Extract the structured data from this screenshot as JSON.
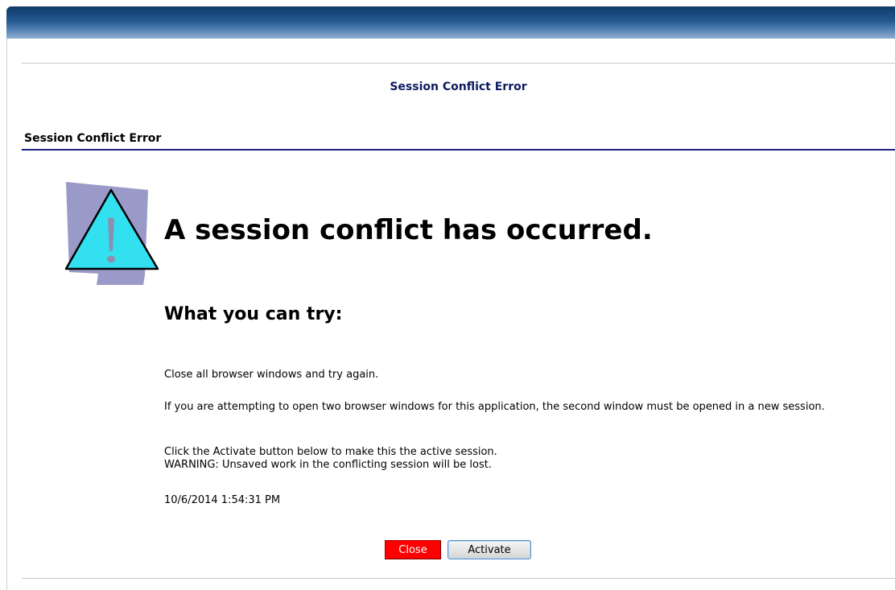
{
  "header": {
    "page_title": "Session Conflict Error",
    "section_heading": "Session Conflict Error"
  },
  "error": {
    "main_heading": "A session conflict has occurred.",
    "sub_heading": "What you can try:",
    "suggestion_1": "Close all browser windows and try again.",
    "suggestion_2": "If you are attempting to open two browser windows for this application, the second window must be opened in a new session.",
    "suggestion_3_line1": "Click the Activate button below to make this the active session.",
    "suggestion_3_line2": "WARNING: Unsaved work in the conflicting session will be lost.",
    "timestamp": "10/6/2014 1:54:31 PM",
    "icon": "warning-icon"
  },
  "buttons": {
    "close_label": "Close",
    "activate_label": "Activate"
  },
  "colors": {
    "banner": "#24588f",
    "title_text": "#0d1b5e",
    "section_rule": "#1a237e",
    "close_button": "#ff0000",
    "warning_triangle": "#33e0f0",
    "warning_backdrop": "#9a9ac8"
  }
}
